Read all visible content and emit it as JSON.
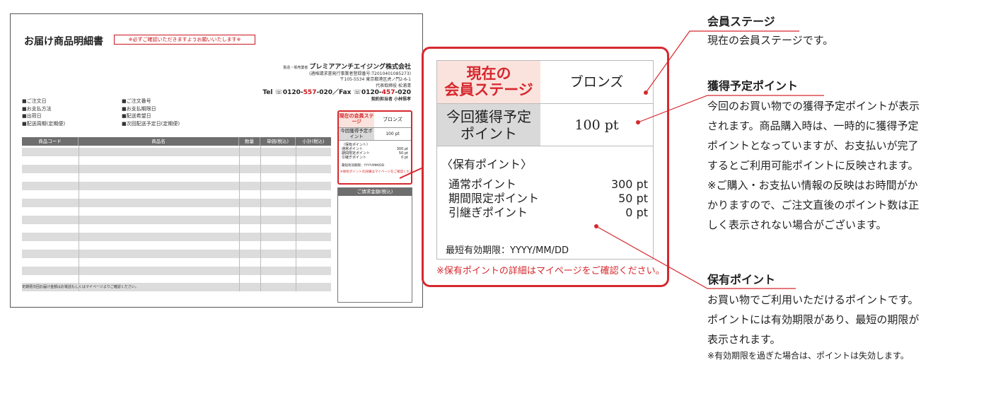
{
  "document": {
    "title": "お届け商品明細書",
    "notice": "※必ずご確認いただきますようお願いいたします※",
    "company": {
      "prefix": "製造・販売業者",
      "name": "プレミアアンチエイジング株式会社",
      "registration": "(適格請求書発行事業者登録番号:T2010401085273)",
      "address": "〒105-5534 東京都港区虎ノ門2-6-1",
      "representative": "代表取締役 松浦清",
      "tel_prefix": "Tel ☏0120-",
      "tel_red": "557",
      "tel_mid": "-020／Fax ☏0120-",
      "fax_red": "457",
      "fax_suffix": "-020",
      "person": "契約担当者 小林悟孝"
    },
    "info_left": [
      "■ご注文日",
      "■お支払方法",
      "■出荷日",
      "■配送周期(定期便)"
    ],
    "info_right": [
      "■ご注文番号",
      "■お支払期限日",
      "■配送希望日",
      "■次回配送予定日(定期便)"
    ],
    "table_headers": [
      "商品コード",
      "商品名",
      "数量",
      "単価(税込)",
      "小計(税込)"
    ],
    "footer_note": "定期便次回お届け金額はお電話もしくはマイページよりご確認ください。",
    "mini_points": {
      "stage_label": "現在の会員ステージ",
      "stage_value": "ブロンズ",
      "earn_label": "今回獲得予定ポイント",
      "earn_value": "100 pt",
      "held_title": "〈保有ポイント〉",
      "rows": [
        {
          "label": "通常ポイント",
          "value": "300 pt"
        },
        {
          "label": "期間限定ポイント",
          "value": "50 pt"
        },
        {
          "label": "引継ぎポイント",
          "value": "0 pt"
        }
      ],
      "expiry": "最短有効期限：YYYY/MM/DD",
      "note": "※保有ポイントの詳細はマイページをご確認ください。"
    },
    "billing_header": "ご請求金額(税込)"
  },
  "panel": {
    "stage_label_1": "現在の",
    "stage_label_2": "会員ステージ",
    "stage_value": "ブロンズ",
    "earn_label_1": "今回獲得予定",
    "earn_label_2": "ポイント",
    "earn_value": "100 pt",
    "held_title": "〈保有ポイント〉",
    "held_rows": [
      {
        "label": "通常ポイント",
        "value": "300 pt"
      },
      {
        "label": "期間限定ポイント",
        "value": "50 pt"
      },
      {
        "label": "引継ぎポイント",
        "value": "0 pt"
      }
    ],
    "expiry": "最短有効期限：YYYY/MM/DD",
    "note": "※保有ポイントの詳細はマイページをご確認ください。"
  },
  "explanations": {
    "stage": {
      "title": "会員ステージ",
      "lines": [
        "現在の会員ステージです。"
      ]
    },
    "earn": {
      "title": "獲得予定ポイント",
      "lines": [
        "今回のお買い物での獲得予定ポイントが表示",
        "されます。商品購入時は、一時的に獲得予定",
        "ポイントとなっていますが、お支払いが完了",
        "するとご利用可能ポイントに反映されます。",
        "※ご購入・お支払い情報の反映はお時間がか",
        "かりますので、ご注文直後のポイント数は正",
        "しく表示されない場合がございます。"
      ]
    },
    "held": {
      "title": "保有ポイント",
      "lines": [
        "お買い物でご利用いただけるポイントです。",
        "ポイントには有効期限があり、最短の期限が",
        "表示されます。"
      ],
      "small": "※有効期限を過ぎた場合は、ポイントは失効します。"
    }
  },
  "colors": {
    "accent_red": "#d6282e",
    "stage_bg": "#fbe3dd",
    "earn_bg": "#d9d9d9",
    "table_header": "#6e6e6e"
  }
}
